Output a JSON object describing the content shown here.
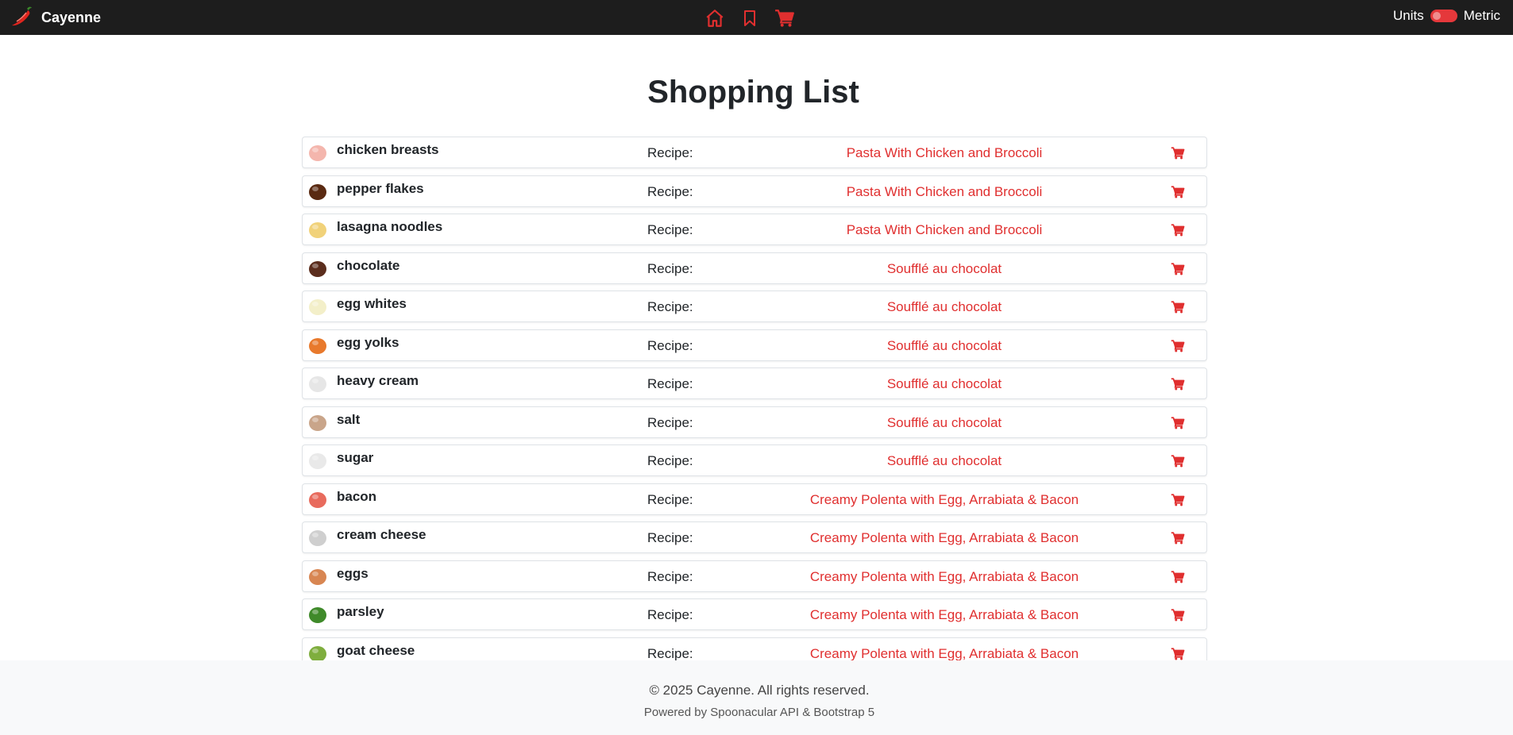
{
  "app": {
    "name": "Cayenne"
  },
  "nav": {
    "icons": [
      "home-icon",
      "bookmark-icon",
      "cart-icon"
    ]
  },
  "units": {
    "label": "Units",
    "mode": "Metric"
  },
  "page": {
    "title": "Shopping List"
  },
  "colors": {
    "accent": "#e02f2f",
    "navbar": "#1d1d1d",
    "footer": "#f8f9fa"
  },
  "items": [
    {
      "name": "chicken breasts",
      "recipe_label": "Recipe:",
      "recipe": "Pasta With Chicken and Broccoli",
      "thumb_color": "#f4b6ad"
    },
    {
      "name": "pepper flakes",
      "recipe_label": "Recipe:",
      "recipe": "Pasta With Chicken and Broccoli",
      "thumb_color": "#5a2a12"
    },
    {
      "name": "lasagna noodles",
      "recipe_label": "Recipe:",
      "recipe": "Pasta With Chicken and Broccoli",
      "thumb_color": "#f1d27a"
    },
    {
      "name": "chocolate",
      "recipe_label": "Recipe:",
      "recipe": "Soufflé au chocolat",
      "thumb_color": "#5b2d1d"
    },
    {
      "name": "egg whites",
      "recipe_label": "Recipe:",
      "recipe": "Soufflé au chocolat",
      "thumb_color": "#f3efc9"
    },
    {
      "name": "egg yolks",
      "recipe_label": "Recipe:",
      "recipe": "Soufflé au chocolat",
      "thumb_color": "#e8792c"
    },
    {
      "name": "heavy cream",
      "recipe_label": "Recipe:",
      "recipe": "Soufflé au chocolat",
      "thumb_color": "#e6e6e6"
    },
    {
      "name": "salt",
      "recipe_label": "Recipe:",
      "recipe": "Soufflé au chocolat",
      "thumb_color": "#c9a58a"
    },
    {
      "name": "sugar",
      "recipe_label": "Recipe:",
      "recipe": "Soufflé au chocolat",
      "thumb_color": "#e9e9e9"
    },
    {
      "name": "bacon",
      "recipe_label": "Recipe:",
      "recipe": "Creamy Polenta with Egg, Arrabiata & Bacon",
      "thumb_color": "#e86b5d"
    },
    {
      "name": "cream cheese",
      "recipe_label": "Recipe:",
      "recipe": "Creamy Polenta with Egg, Arrabiata & Bacon",
      "thumb_color": "#cfcfcf"
    },
    {
      "name": "eggs",
      "recipe_label": "Recipe:",
      "recipe": "Creamy Polenta with Egg, Arrabiata & Bacon",
      "thumb_color": "#d88652"
    },
    {
      "name": "parsley",
      "recipe_label": "Recipe:",
      "recipe": "Creamy Polenta with Egg, Arrabiata & Bacon",
      "thumb_color": "#3f8a2a"
    },
    {
      "name": "goat cheese",
      "recipe_label": "Recipe:",
      "recipe": "Creamy Polenta with Egg, Arrabiata & Bacon",
      "thumb_color": "#7fae3e"
    }
  ],
  "footer": {
    "copyright": "© 2025 Cayenne. All rights reserved.",
    "powered": "Powered by Spoonacular API & Bootstrap 5"
  }
}
